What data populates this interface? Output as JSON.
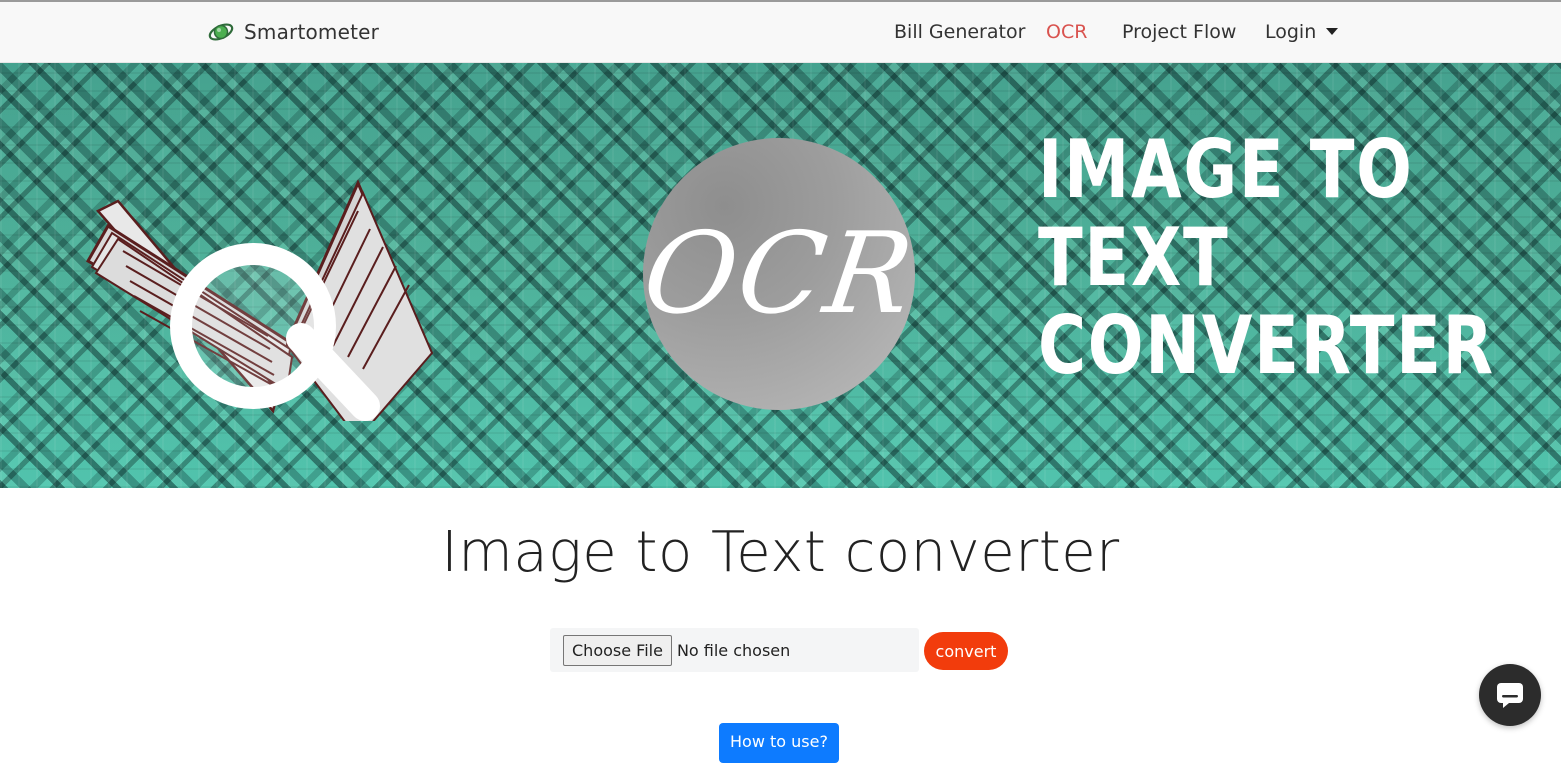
{
  "navbar": {
    "brand": "Smartometer",
    "links": {
      "bill_generator": "Bill Generator",
      "ocr": "OCR",
      "project_flow": "Project Flow",
      "login": "Login"
    },
    "active_link": "OCR",
    "active_color": "#d9534f"
  },
  "hero": {
    "circle_text": "OCR",
    "title_lines": [
      "IMAGE TO",
      "TEXT",
      "CONVERTER"
    ]
  },
  "main": {
    "title": "Image to Text converter",
    "file_input": {
      "button_label": "Choose File",
      "status": "No file chosen"
    },
    "convert_label": "convert",
    "convert_color": "#f23c0c",
    "howto_label": "How to use?",
    "howto_color": "#0d7bff"
  },
  "chat_widget": {
    "icon": "chat-bubble-icon"
  }
}
